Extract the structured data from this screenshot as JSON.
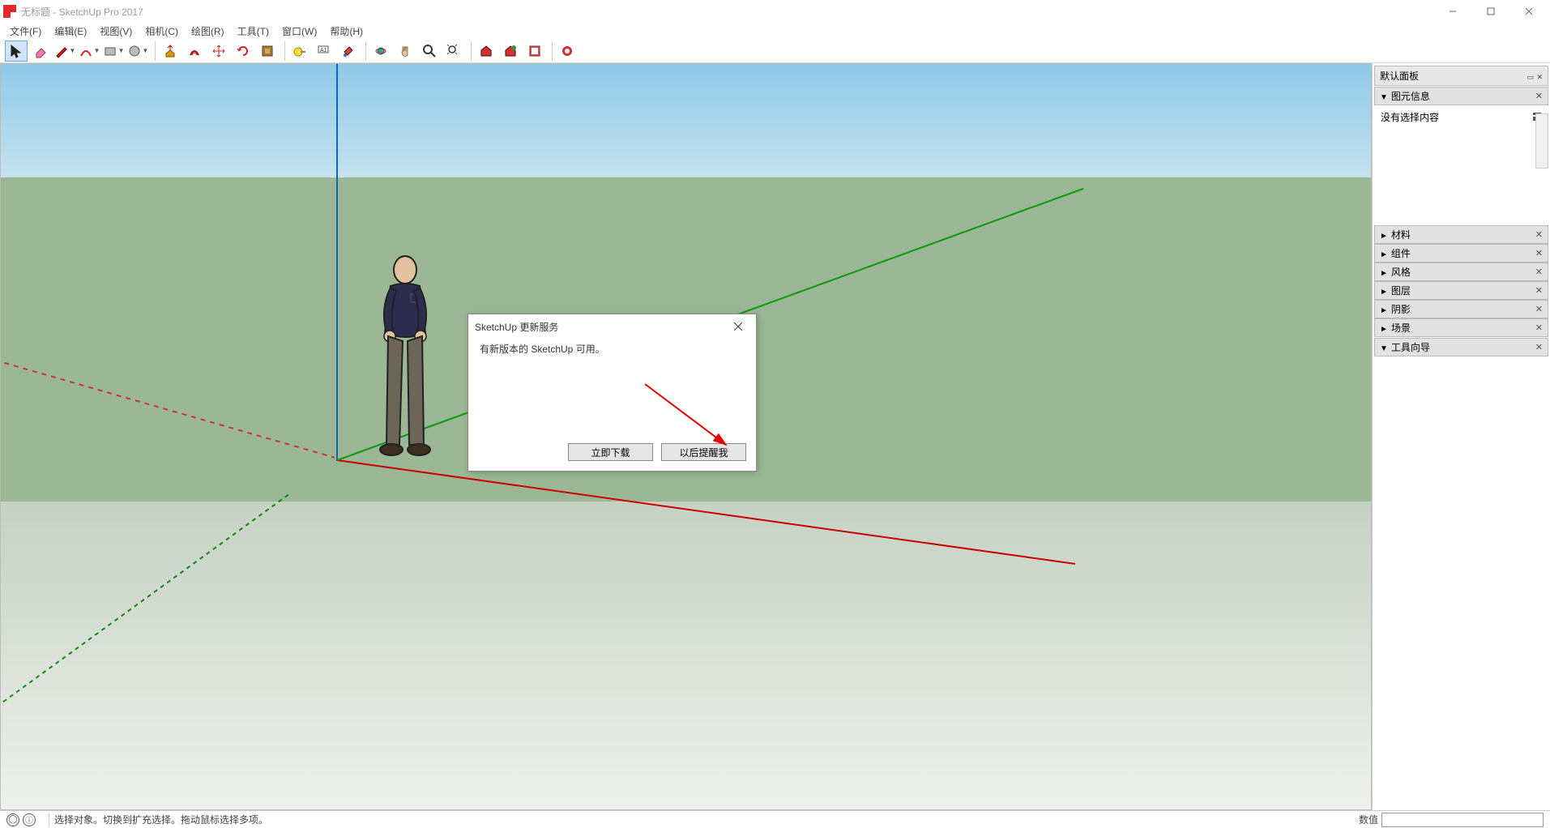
{
  "title_bar": {
    "title": "无标题 - SketchUp Pro 2017"
  },
  "menu": {
    "items": [
      "文件(F)",
      "编辑(E)",
      "视图(V)",
      "相机(C)",
      "绘图(R)",
      "工具(T)",
      "窗口(W)",
      "帮助(H)"
    ]
  },
  "toolbar": {
    "tools": [
      {
        "name": "select-tool",
        "icon": "cursor",
        "active": true
      },
      {
        "name": "eraser-tool",
        "icon": "eraser"
      },
      {
        "name": "line-tool",
        "icon": "pencil",
        "dd": true
      },
      {
        "name": "arc-tool",
        "icon": "arc",
        "dd": true
      },
      {
        "name": "rectangle-tool",
        "icon": "rect",
        "dd": true
      },
      {
        "name": "circle-tool",
        "icon": "circle",
        "dd": true
      },
      {
        "name": "sep"
      },
      {
        "name": "pushpull-tool",
        "icon": "pushpull"
      },
      {
        "name": "offset-tool",
        "icon": "offset"
      },
      {
        "name": "move-tool",
        "icon": "move"
      },
      {
        "name": "rotate-tool",
        "icon": "rotate"
      },
      {
        "name": "scale-tool",
        "icon": "scale"
      },
      {
        "name": "sep"
      },
      {
        "name": "tape-tool",
        "icon": "tape"
      },
      {
        "name": "text-tool",
        "icon": "text"
      },
      {
        "name": "paint-tool",
        "icon": "paint"
      },
      {
        "name": "sep"
      },
      {
        "name": "orbit-tool",
        "icon": "orbit"
      },
      {
        "name": "pan-tool",
        "icon": "pan"
      },
      {
        "name": "zoom-tool",
        "icon": "zoom"
      },
      {
        "name": "zoom-extents-tool",
        "icon": "zoomextents"
      },
      {
        "name": "sep"
      },
      {
        "name": "warehouse-tool",
        "icon": "warehouse"
      },
      {
        "name": "ext-warehouse-tool",
        "icon": "extwarehouse"
      },
      {
        "name": "layout-tool",
        "icon": "layout"
      },
      {
        "name": "sep"
      },
      {
        "name": "extension-tool",
        "icon": "extension"
      }
    ]
  },
  "dialog": {
    "title": "SketchUp 更新服务",
    "message": "有新版本的 SketchUp 可用。",
    "button_download": "立即下载",
    "button_later": "以后提醒我"
  },
  "side_panel": {
    "header": "默认面板",
    "entity_info": {
      "title": "图元信息",
      "body": "没有选择内容"
    },
    "sections": [
      "材料",
      "组件",
      "风格",
      "图层",
      "阴影",
      "场景"
    ],
    "instructor": "工具向导"
  },
  "status_bar": {
    "hint": "选择对象。切换到扩充选择。拖动鼠标选择多项。",
    "value_label": "数值"
  }
}
